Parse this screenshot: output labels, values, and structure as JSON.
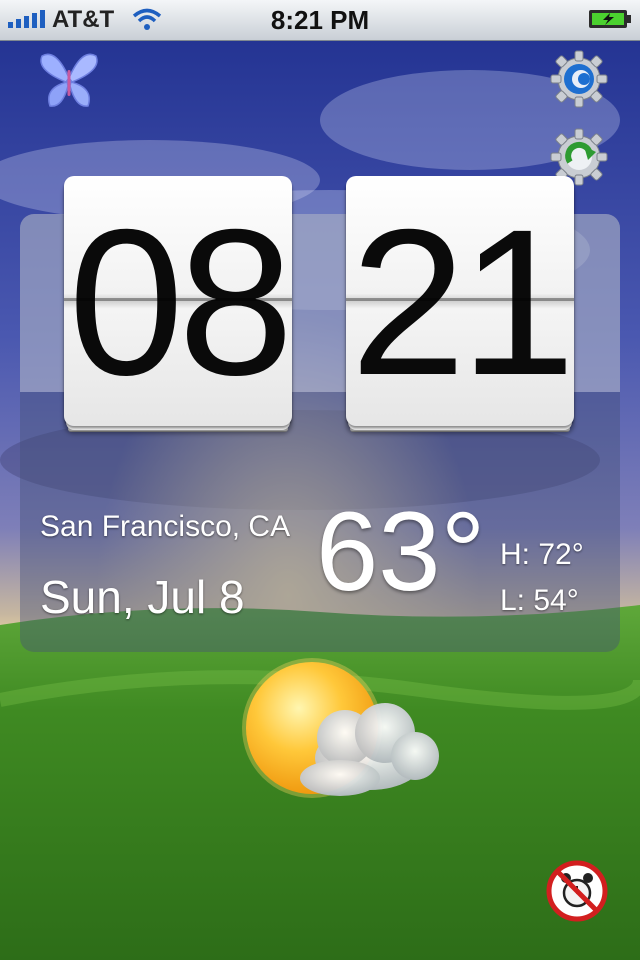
{
  "status_bar": {
    "carrier": "AT&T",
    "time": "8:21 PM",
    "battery": "charging"
  },
  "icons": {
    "butterfly": "butterfly-icon",
    "settings": "settings-gear-icon",
    "refresh": "refresh-gear-icon",
    "weather": "partly-cloudy-icon",
    "alarm_off": "alarm-off-icon"
  },
  "clock": {
    "hours": "08",
    "minutes": "21"
  },
  "weather": {
    "city": "San Francisco, CA",
    "date": "Sun, Jul 8",
    "temperature": "63°",
    "high": "H: 72°",
    "low": "L: 54°"
  },
  "colors": {
    "sky_top": "#2a3a9e",
    "grass": "#3f8a22",
    "accent_blue": "#1e6fd0"
  }
}
